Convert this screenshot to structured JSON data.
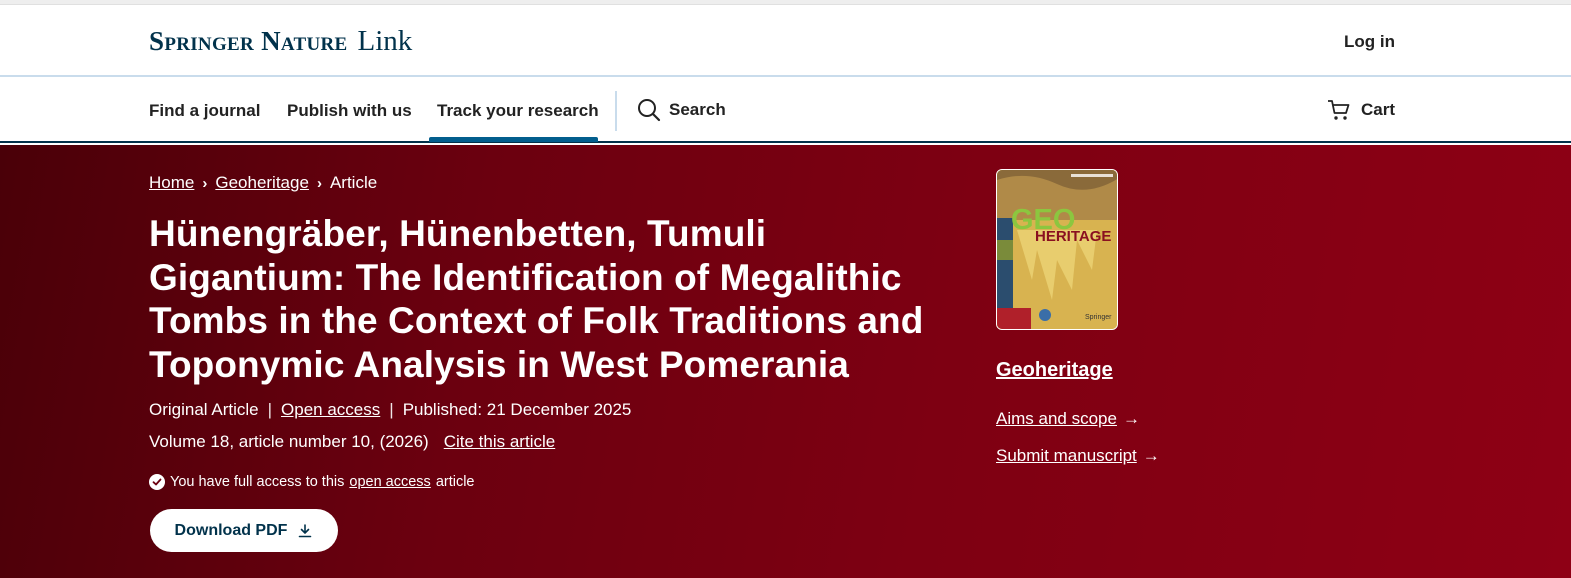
{
  "header": {
    "brand_springer": "Springer Nature",
    "brand_link": "Link",
    "login_label": "Log in"
  },
  "nav": {
    "items": [
      {
        "label": "Find a journal"
      },
      {
        "label": "Publish with us"
      },
      {
        "label": "Track your research",
        "active": true
      }
    ],
    "search_label": "Search",
    "cart_label": "Cart",
    "active_color": "#025e8d"
  },
  "breadcrumb": {
    "items": [
      "Home",
      "Geoheritage",
      "Article"
    ]
  },
  "article": {
    "title": "Hünengräber, Hünenbetten, Tumuli Gigantium: The Identification of Megalithic Tombs in the Context of Folk Traditions and Toponymic Analysis in West Pomerania",
    "type": "Original Article",
    "access": "Open access",
    "published": "Published: 21 December 2025",
    "volume": "Volume 18, article number 10, (2026)",
    "cite_label": "Cite this article",
    "access_note_prefix": "You have full access to this",
    "access_note_link": "open access",
    "access_note_suffix": "article",
    "download_label": "Download PDF"
  },
  "journal": {
    "cover_geo": "GEO",
    "cover_heritage": "HERITAGE",
    "cover_publisher": "Springer",
    "name": "Geoheritage",
    "aims_label": "Aims and scope",
    "submit_label": "Submit manuscript"
  },
  "colors": {
    "hero_start": "#4a0008",
    "hero_end": "#8e0015",
    "brand_navy": "#01324b"
  }
}
